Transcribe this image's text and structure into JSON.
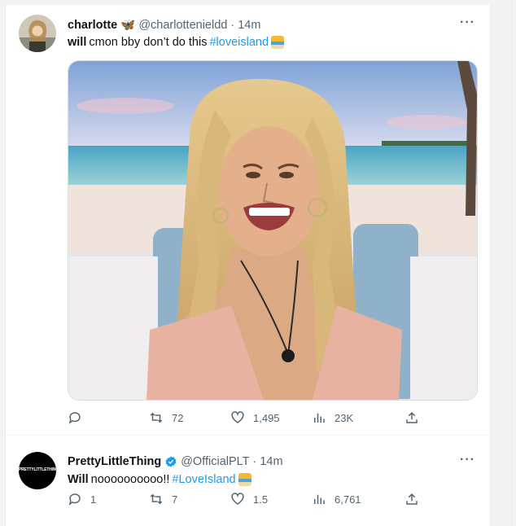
{
  "tweets": [
    {
      "name": "charlotte",
      "name_emoji": "🦋",
      "handle": "@charlottenieldd",
      "separator": "·",
      "time": "14m",
      "text_lead": "will",
      "text_body": "cmon bby don’t do this",
      "hashtag": "#loveisland",
      "avatar_icon": "user-avatar",
      "stats": {
        "reply": "",
        "retweet": "72",
        "like": "1,495",
        "views": "23K"
      }
    },
    {
      "name": "PrettyLittleThing",
      "handle": "@OfficialPLT",
      "separator": "·",
      "time": "14m",
      "text_lead": "Will",
      "text_body": "noooooooooo!!",
      "hashtag": "#LoveIsland",
      "avatar_text": "PRETTYLITTLETHING",
      "stats": {
        "reply": "1",
        "retweet": "7",
        "like": "1.5",
        "views": "6,761"
      }
    }
  ],
  "colors": {
    "accent": "#1d9bf0",
    "muted": "#536471",
    "text": "#0f1419"
  },
  "icons": [
    "butterfly-emoji",
    "island-emoji",
    "verified-badge-icon",
    "reply-icon",
    "retweet-icon",
    "like-icon",
    "views-icon",
    "share-icon",
    "more-icon"
  ]
}
